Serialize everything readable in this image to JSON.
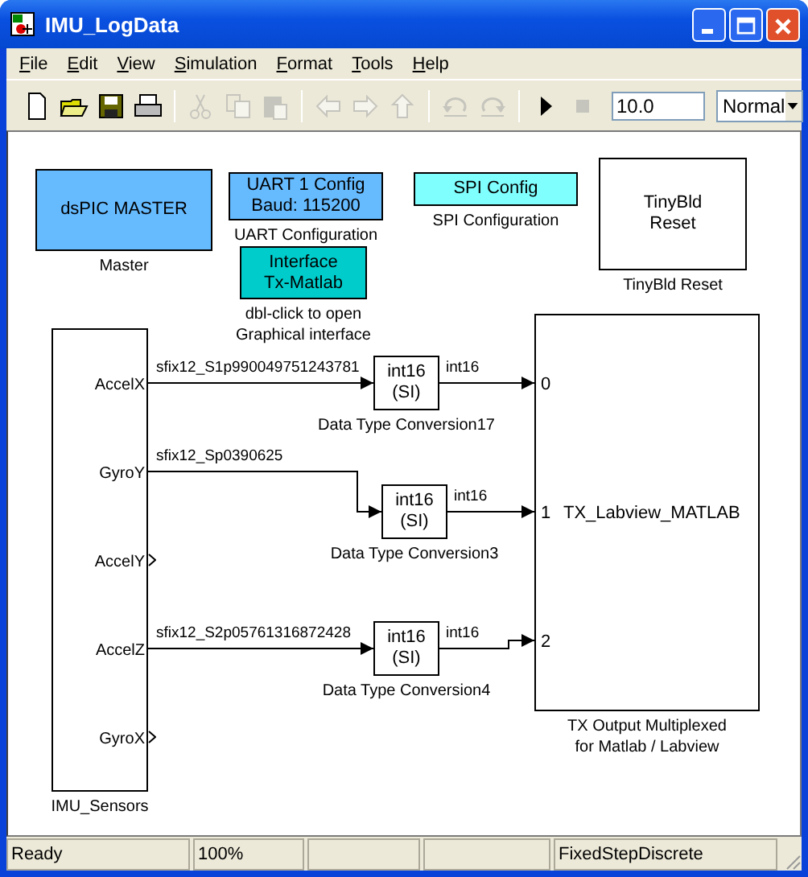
{
  "window": {
    "title": "IMU_LogData"
  },
  "menu": [
    {
      "label": "File"
    },
    {
      "label": "Edit"
    },
    {
      "label": "View"
    },
    {
      "label": "Simulation"
    },
    {
      "label": "Format"
    },
    {
      "label": "Tools"
    },
    {
      "label": "Help"
    }
  ],
  "toolbar": {
    "groups": [
      [
        {
          "kind": "new",
          "disabled": false
        },
        {
          "kind": "open",
          "disabled": false
        },
        {
          "kind": "save",
          "disabled": false
        },
        {
          "kind": "print",
          "disabled": false
        }
      ],
      [
        {
          "kind": "cut",
          "disabled": true
        },
        {
          "kind": "copy",
          "disabled": true
        },
        {
          "kind": "paste",
          "disabled": true
        }
      ],
      [
        {
          "kind": "back",
          "disabled": true
        },
        {
          "kind": "forward",
          "disabled": true
        },
        {
          "kind": "up",
          "disabled": true
        }
      ],
      [
        {
          "kind": "undo",
          "disabled": true
        },
        {
          "kind": "redo",
          "disabled": true
        }
      ],
      [
        {
          "kind": "start",
          "disabled": false
        },
        {
          "kind": "stop",
          "disabled": true
        }
      ]
    ],
    "stop_time": "10.0",
    "mode": "Normal"
  },
  "blocks": [
    {
      "kind": "config",
      "lines": [
        "dsPIC MASTER"
      ],
      "caption": [
        "Master"
      ],
      "color": "#66bbff"
    },
    {
      "kind": "config",
      "lines": [
        "UART 1 Config",
        "Baud: 115200"
      ],
      "caption": [
        "UART Configuration"
      ],
      "color": "#66bbff"
    },
    {
      "kind": "config",
      "lines": [
        "SPI Config"
      ],
      "caption": [
        "SPI Configuration"
      ],
      "color": "#80ffff"
    },
    {
      "kind": "config",
      "lines": [
        "TinyBld",
        "Reset"
      ],
      "caption": [
        "TinyBld Reset"
      ],
      "color": "#ffffff"
    },
    {
      "kind": "config",
      "lines": [
        "Interface",
        "Tx-Matlab"
      ],
      "caption": [
        "dbl-click to open",
        "Graphical interface"
      ],
      "color": "#00cccc"
    },
    {
      "kind": "subsystem",
      "caption": [
        "IMU_Sensors"
      ],
      "ports": [
        {
          "label": "AccelX",
          "connected": true
        },
        {
          "label": "GyroY",
          "connected": true
        },
        {
          "label": "AccelY",
          "connected": false
        },
        {
          "label": "AccelZ",
          "connected": true
        },
        {
          "label": "GyroX",
          "connected": false
        }
      ]
    },
    {
      "kind": "conversion",
      "lines": [
        "int16",
        "(SI)"
      ],
      "caption": [
        "Data Type Conversion17"
      ],
      "in_label": "sfix12_S1p990049751243781",
      "out_label": "int16"
    },
    {
      "kind": "conversion",
      "lines": [
        "int16",
        "(SI)"
      ],
      "caption": [
        "Data Type Conversion3"
      ],
      "in_label": "sfix12_Sp0390625",
      "out_label": "int16"
    },
    {
      "kind": "conversion",
      "lines": [
        "int16",
        "(SI)"
      ],
      "caption": [
        "Data Type Conversion4"
      ],
      "in_label": "sfix12_S2p05761316872428",
      "out_label": "int16"
    },
    {
      "kind": "mux",
      "inputs": [
        "0",
        "1",
        "2"
      ],
      "text": "TX_Labview_MATLAB",
      "caption": [
        "TX Output Multiplexed",
        "for Matlab / Labview"
      ]
    }
  ],
  "status_bar": {
    "status": "Ready",
    "zoom": "100%",
    "solver": "FixedStepDiscrete"
  }
}
